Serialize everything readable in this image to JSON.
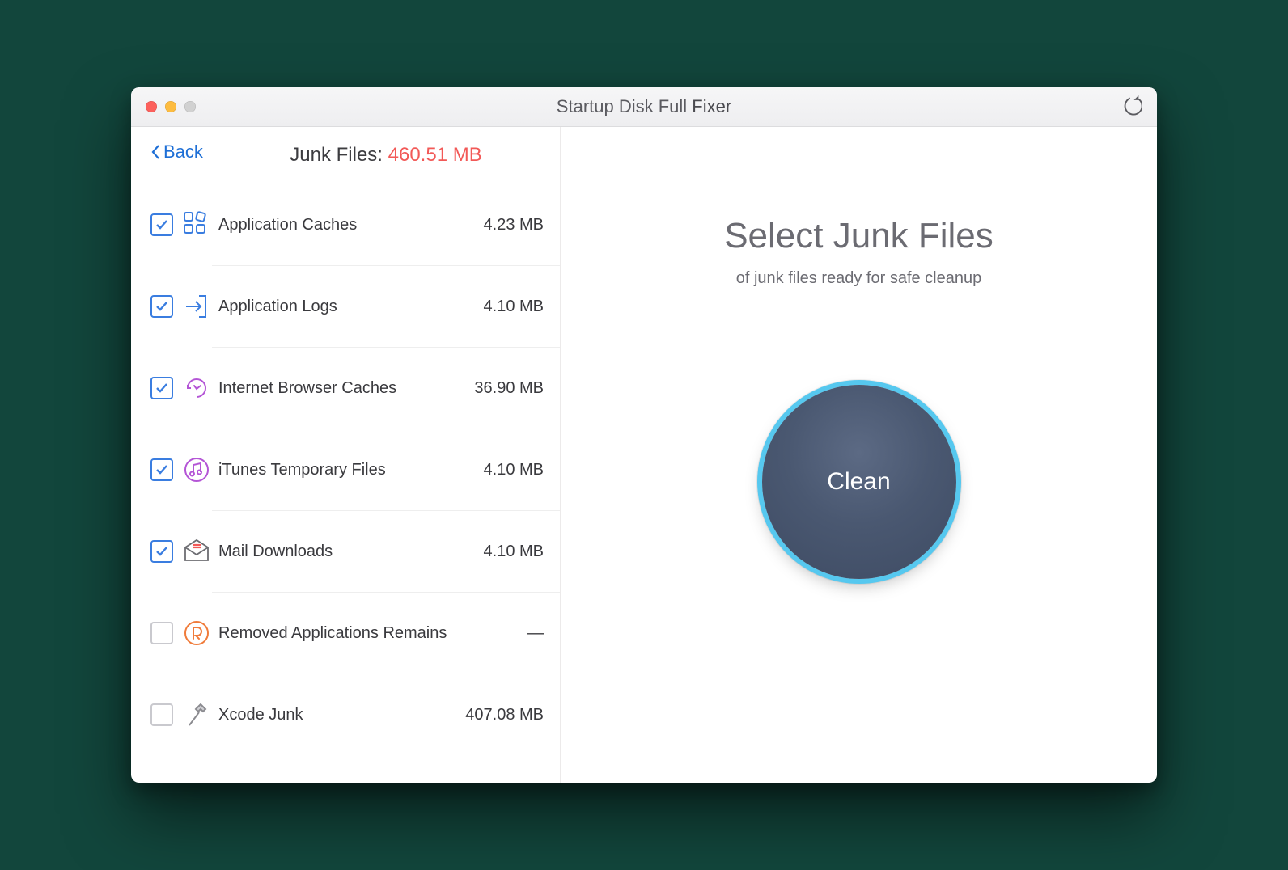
{
  "window": {
    "title_prefix": "Startup Disk Full ",
    "title_bold": "Fixer"
  },
  "left": {
    "back_label": "Back",
    "header_label": "Junk Files: ",
    "header_size": "460.51 MB"
  },
  "categories": [
    {
      "label": "Application Caches",
      "size": "4.23 MB",
      "checked": true,
      "icon": "apps"
    },
    {
      "label": "Application Logs",
      "size": "4.10 MB",
      "checked": true,
      "icon": "login"
    },
    {
      "label": "Internet Browser Caches",
      "size": "36.90 MB",
      "checked": true,
      "icon": "browser"
    },
    {
      "label": "iTunes Temporary Files",
      "size": "4.10 MB",
      "checked": true,
      "icon": "itunes"
    },
    {
      "label": "Mail Downloads",
      "size": "4.10 MB",
      "checked": true,
      "icon": "mail"
    },
    {
      "label": "Removed Applications Remains",
      "size": "—",
      "checked": false,
      "icon": "registry"
    },
    {
      "label": "Xcode Junk",
      "size": "407.08 MB",
      "checked": false,
      "icon": "hammer"
    }
  ],
  "right": {
    "heading": "Select Junk Files",
    "sub": "of junk files ready for safe cleanup",
    "clean_label": "Clean"
  }
}
